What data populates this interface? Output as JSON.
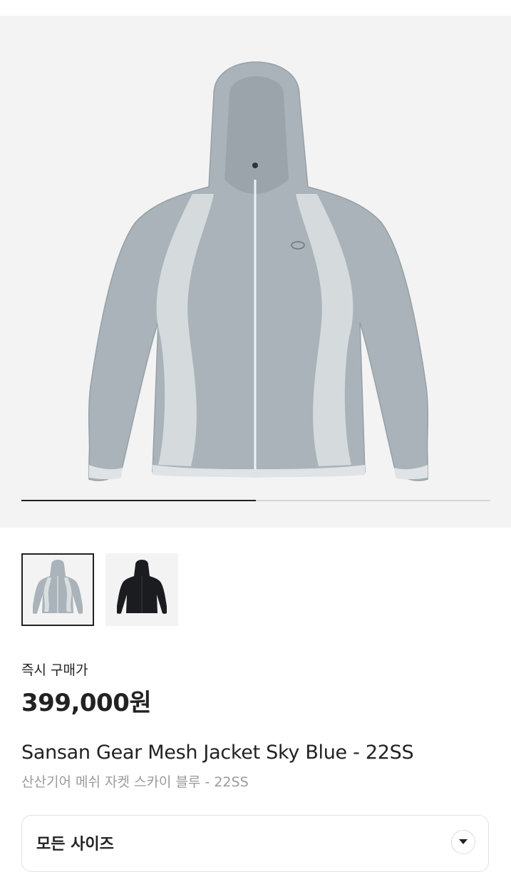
{
  "gallery": {
    "current_image_fraction": 0.5,
    "thumbnails": [
      {
        "name": "sky-blue-jacket",
        "color": "#a9b3b9",
        "selected": true
      },
      {
        "name": "black-jacket",
        "color": "#1b1c20",
        "selected": false
      }
    ]
  },
  "product": {
    "price_label": "즉시 구매가",
    "price": "399,000원",
    "name_en": "Sansan Gear Mesh Jacket Sky Blue - 22SS",
    "name_ko": "산산기어 메쉬 자켓 스카이 블루 - 22SS"
  },
  "size_select": {
    "label": "모든 사이즈",
    "icon": "chevron-down-icon"
  },
  "colors": {
    "jacket": "#a9b3b9",
    "mesh": "#d9dee1",
    "background": "#f3f3f3",
    "text": "#222222",
    "muted": "#9a9a9a"
  }
}
